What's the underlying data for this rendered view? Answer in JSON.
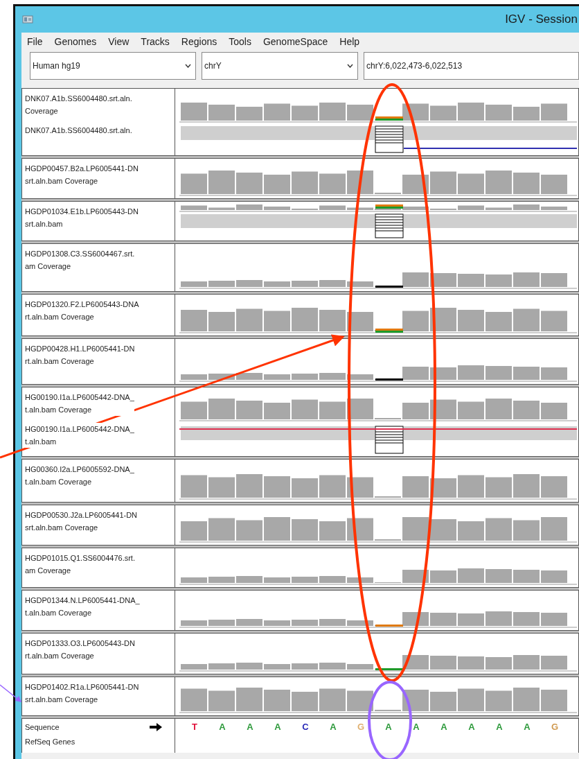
{
  "window": {
    "title": "IGV - Session"
  },
  "menu": [
    "File",
    "Genomes",
    "View",
    "Tracks",
    "Regions",
    "Tools",
    "GenomeSpace",
    "Help"
  ],
  "toolbar": {
    "genome": "Human hg19",
    "chromosome": "chrY",
    "locus": "chrY:6,022,473-6,022,513"
  },
  "tracks": [
    {
      "kind": "coverage_alignment",
      "labels": [
        [
          "DNK07.A1b.SS6004480.srt.aln.",
          "Coverage"
        ],
        [
          "DNK07.A1b.SS6004480.srt.aln."
        ]
      ]
    },
    {
      "kind": "coverage",
      "labels": [
        [
          "HGDP00457.B2a.LP6005441-DN",
          "srt.aln.bam Coverage"
        ]
      ]
    },
    {
      "kind": "alignment",
      "labels": [
        [
          "HGDP01034.E1b.LP6005443-DN",
          "srt.aln.bam"
        ]
      ]
    },
    {
      "kind": "coverage",
      "labels": [
        [
          "HGDP01308.C3.SS6004467.srt.",
          "am Coverage"
        ]
      ]
    },
    {
      "kind": "coverage",
      "labels": [
        [
          "HGDP01320.F2.LP6005443-DNA",
          "rt.aln.bam Coverage"
        ]
      ]
    },
    {
      "kind": "coverage",
      "labels": [
        [
          "HGDP00428.H1.LP6005441-DN",
          "rt.aln.bam Coverage"
        ]
      ]
    },
    {
      "kind": "coverage_alignment",
      "labels": [
        [
          "HG00190.I1a.LP6005442-DNA_",
          "t.aln.bam Coverage"
        ],
        [
          "HG00190.I1a.LP6005442-DNA_",
          "t.aln.bam"
        ]
      ]
    },
    {
      "kind": "coverage",
      "labels": [
        [
          "HG00360.I2a.LP6005592-DNA_",
          "t.aln.bam Coverage"
        ]
      ]
    },
    {
      "kind": "coverage",
      "labels": [
        [
          "HGDP00530.J2a.LP6005441-DN",
          "srt.aln.bam Coverage"
        ]
      ]
    },
    {
      "kind": "coverage",
      "labels": [
        [
          "HGDP01015.Q1.SS6004476.srt.",
          "am Coverage"
        ]
      ]
    },
    {
      "kind": "coverage",
      "labels": [
        [
          "HGDP01344.N.LP6005441-DNA_",
          "t.aln.bam Coverage"
        ]
      ]
    },
    {
      "kind": "coverage",
      "labels": [
        [
          "HGDP01333.O3.LP6005443-DN",
          "rt.aln.bam Coverage"
        ]
      ]
    },
    {
      "kind": "coverage",
      "labels": [
        [
          "HGDP01402.R1a.LP6005441-DN",
          "srt.aln.bam Coverage"
        ]
      ]
    }
  ],
  "sequence": {
    "labels": [
      "Sequence",
      "RefSeq Genes"
    ],
    "bases": [
      {
        "base": "T",
        "color": "#e0103a"
      },
      {
        "base": "A",
        "color": "#2e9a3c"
      },
      {
        "base": "A",
        "color": "#2e9a3c"
      },
      {
        "base": "A",
        "color": "#2e9a3c"
      },
      {
        "base": "C",
        "color": "#2a2ab8"
      },
      {
        "base": "A",
        "color": "#2e9a3c"
      },
      {
        "base": "G",
        "color": "#e0b070"
      },
      {
        "base": "A",
        "color": "#2e9a3c"
      },
      {
        "base": "A",
        "color": "#2e9a3c"
      },
      {
        "base": "A",
        "color": "#2e9a3c"
      },
      {
        "base": "A",
        "color": "#2e9a3c"
      },
      {
        "base": "A",
        "color": "#2e9a3c"
      },
      {
        "base": "A",
        "color": "#2e9a3c"
      },
      {
        "base": "G",
        "color": "#d09a50"
      }
    ]
  },
  "annotations": [
    {
      "kind": "ellipse",
      "color": "#ff3300"
    },
    {
      "kind": "arrow",
      "color": "#ff3300"
    },
    {
      "kind": "ellipse",
      "color": "#9966ff"
    },
    {
      "kind": "arrow",
      "color": "#9966ff"
    }
  ]
}
